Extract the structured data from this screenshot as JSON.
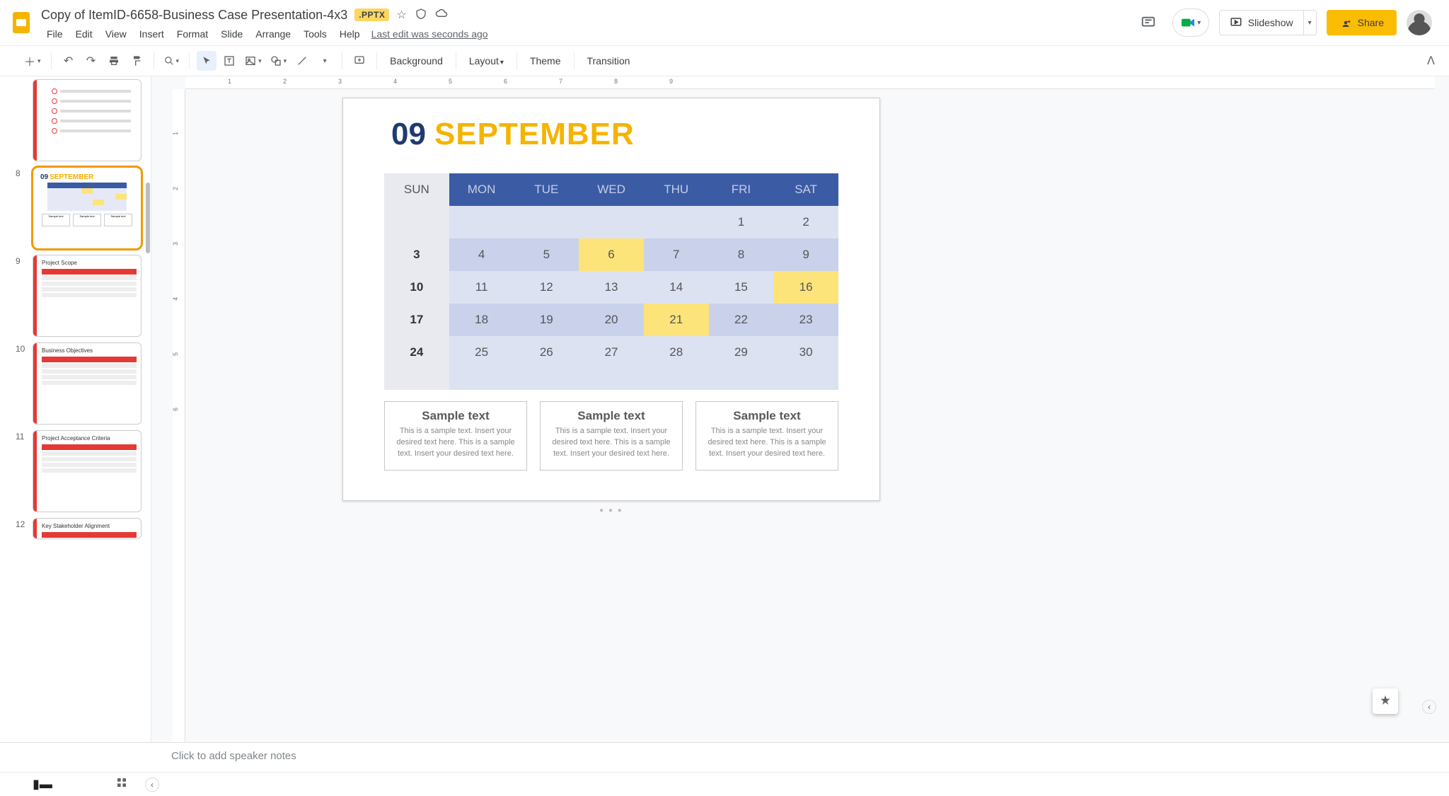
{
  "header": {
    "title": "Copy of ItemID-6658-Business Case Presentation-4x3",
    "badge": ".PPTX",
    "last_edit": "Last edit was seconds ago",
    "menus": [
      "File",
      "Edit",
      "View",
      "Insert",
      "Format",
      "Slide",
      "Arrange",
      "Tools",
      "Help"
    ],
    "slideshow": "Slideshow",
    "share": "Share"
  },
  "toolbar": {
    "background": "Background",
    "layout": "Layout",
    "theme": "Theme",
    "transition": "Transition"
  },
  "thumbnails": {
    "selected": 8,
    "visible": [
      {
        "n": "",
        "title": ""
      },
      {
        "n": "8",
        "title": "09 SEPTEMBER"
      },
      {
        "n": "9",
        "title": "Project Scope"
      },
      {
        "n": "10",
        "title": "Business Objectives"
      },
      {
        "n": "11",
        "title": "Project Acceptance Criteria"
      },
      {
        "n": "12",
        "title": "Key Stakeholder Alignment"
      }
    ]
  },
  "slide": {
    "num": "09",
    "month": "SEPTEMBER",
    "days": [
      "SUN",
      "MON",
      "TUE",
      "WED",
      "THU",
      "FRI",
      "SAT"
    ],
    "rows": [
      {
        "cells": [
          "",
          "",
          "",
          "",
          "",
          "1",
          "2"
        ],
        "hl": []
      },
      {
        "cells": [
          "3",
          "4",
          "5",
          "6",
          "7",
          "8",
          "9"
        ],
        "hl": [
          3
        ]
      },
      {
        "cells": [
          "10",
          "11",
          "12",
          "13",
          "14",
          "15",
          "16"
        ],
        "hl": [
          6
        ]
      },
      {
        "cells": [
          "17",
          "18",
          "19",
          "20",
          "21",
          "22",
          "23"
        ],
        "hl": [
          4
        ]
      },
      {
        "cells": [
          "24",
          "25",
          "26",
          "27",
          "28",
          "29",
          "30"
        ],
        "hl": []
      }
    ],
    "samples": [
      {
        "h": "Sample text",
        "p": "This is a sample text. Insert your desired text here. This is a sample text. Insert your desired text here."
      },
      {
        "h": "Sample text",
        "p": "This is a sample text. Insert your desired text here. This is a sample text. Insert your desired text here."
      },
      {
        "h": "Sample text",
        "p": "This is a sample text. Insert your desired text here. This is a sample text. Insert your desired text here."
      }
    ]
  },
  "notes": {
    "placeholder": "Click to add speaker notes"
  },
  "ruler": {
    "h": [
      "1",
      "2",
      "3",
      "4",
      "5",
      "6",
      "7",
      "8",
      "9"
    ],
    "v": [
      "1",
      "2",
      "3",
      "4",
      "5",
      "6"
    ]
  }
}
